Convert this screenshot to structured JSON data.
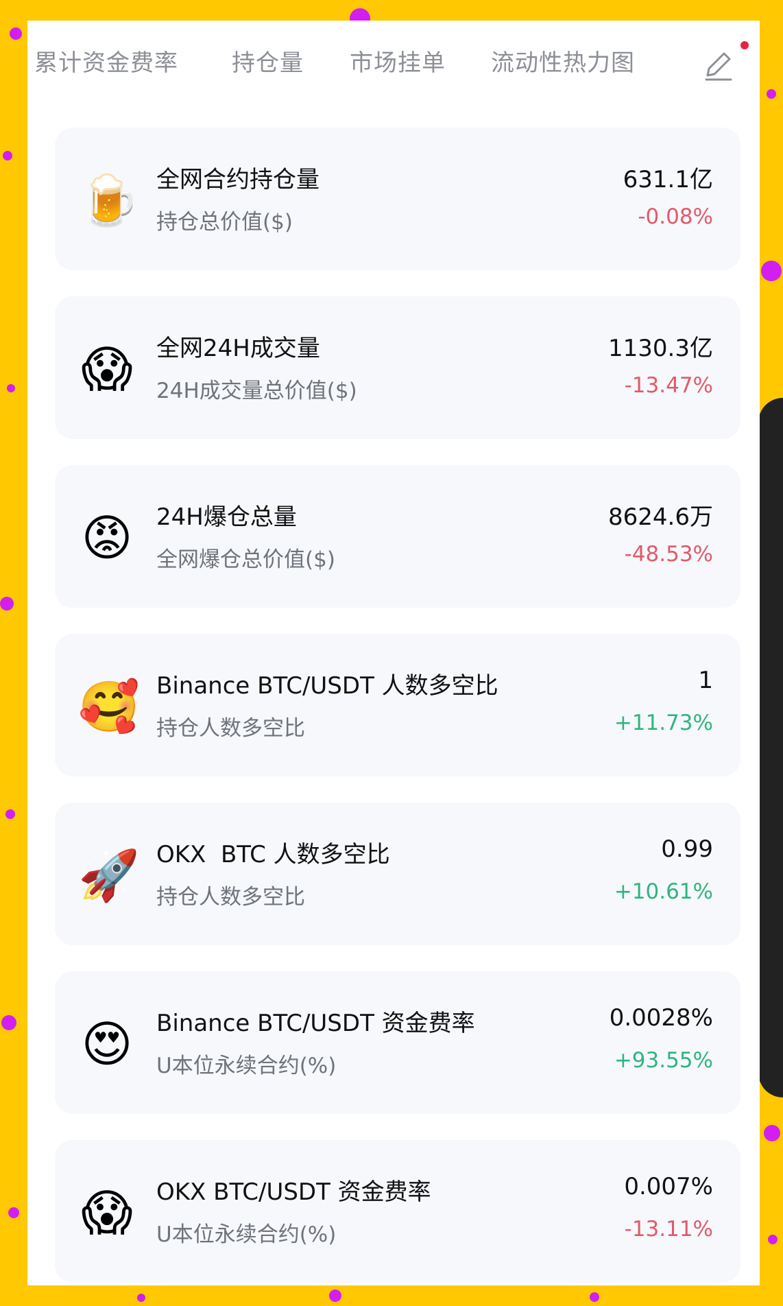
{
  "tabs": [
    "累计资金费率",
    "持仓量",
    "市场挂单",
    "流动性热力图"
  ],
  "colors": {
    "background": "#FFC800",
    "dots": "#D21EF0",
    "panel": "#FFFFFF",
    "card": "#F6F8FC",
    "negative": "#E25A6A",
    "positive": "#2FB57E",
    "tab_text": "#8C8F96",
    "notification_dot": "#E8243D"
  },
  "toolbar": {
    "edit_icon": "pencil-icon",
    "has_notification": true
  },
  "items": [
    {
      "icon": "beer-mug-icon",
      "emoji": "🍺",
      "title": "全网合约持仓量",
      "subtitle": "持仓总价值($)",
      "value": "631.1亿",
      "change": "-0.08%",
      "trend": "negative"
    },
    {
      "icon": "screaming-face-icon",
      "emoji": "😱",
      "title": "全网24H成交量",
      "subtitle": "24H成交量总价值($)",
      "value": "1130.3亿",
      "change": "-13.47%",
      "trend": "negative"
    },
    {
      "icon": "angry-face-icon",
      "emoji": "😡",
      "title": "24H爆仓总量",
      "subtitle": "全网爆仓总价值($)",
      "value": "8624.6万",
      "change": "-48.53%",
      "trend": "negative"
    },
    {
      "icon": "smiling-face-with-hearts-icon",
      "emoji": "🥰",
      "title": "Binance BTC/USDT 人数多空比",
      "subtitle": "持仓人数多空比",
      "value": "1",
      "change": "+11.73%",
      "trend": "positive"
    },
    {
      "icon": "rocket-icon",
      "emoji": "🚀",
      "title": "OKX  BTC 人数多空比",
      "subtitle": "持仓人数多空比",
      "value": "0.99",
      "change": "+10.61%",
      "trend": "positive"
    },
    {
      "icon": "heart-eyes-face-icon",
      "emoji": "😍",
      "title": "Binance BTC/USDT 资金费率",
      "subtitle": "U本位永续合约(%)",
      "value": "0.0028%",
      "change": "+93.55%",
      "trend": "positive"
    },
    {
      "icon": "screaming-face-icon",
      "emoji": "😱",
      "title": "OKX BTC/USDT 资金费率",
      "subtitle": "U本位永续合约(%)",
      "value": "0.007%",
      "change": "-13.11%",
      "trend": "negative"
    }
  ]
}
